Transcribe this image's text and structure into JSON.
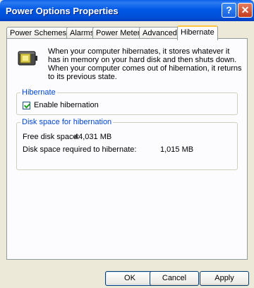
{
  "window": {
    "title": "Power Options Properties"
  },
  "titlebar_buttons": {
    "help": "?",
    "close": "✕"
  },
  "tabs": [
    "Power Schemes",
    "Alarms",
    "Power Meter",
    "Advanced",
    "Hibernate"
  ],
  "active_tab": "Hibernate",
  "intro_text": "When your computer hibernates, it stores whatever it has in memory on your hard disk and then shuts down. When your computer comes out of hibernation, it returns to its previous state.",
  "hibernate_group": {
    "label": "Hibernate",
    "checkbox_label": "Enable hibernation",
    "checked": true
  },
  "disk_group": {
    "label": "Disk space for hibernation",
    "free_label": "Free disk space:",
    "free_value": "44,031 MB",
    "required_label": "Disk space required to hibernate:",
    "required_value": "1,015 MB"
  },
  "buttons": {
    "ok": "OK",
    "cancel": "Cancel",
    "apply": "Apply"
  },
  "icons": {
    "battery": "battery-icon",
    "help": "help-icon",
    "close": "close-icon",
    "check": "check-icon"
  },
  "colors": {
    "titlebar": "#0054E3",
    "group_label": "#0046D5",
    "tab_highlight": "#FFC83C",
    "close_button": "#C23A1A"
  }
}
